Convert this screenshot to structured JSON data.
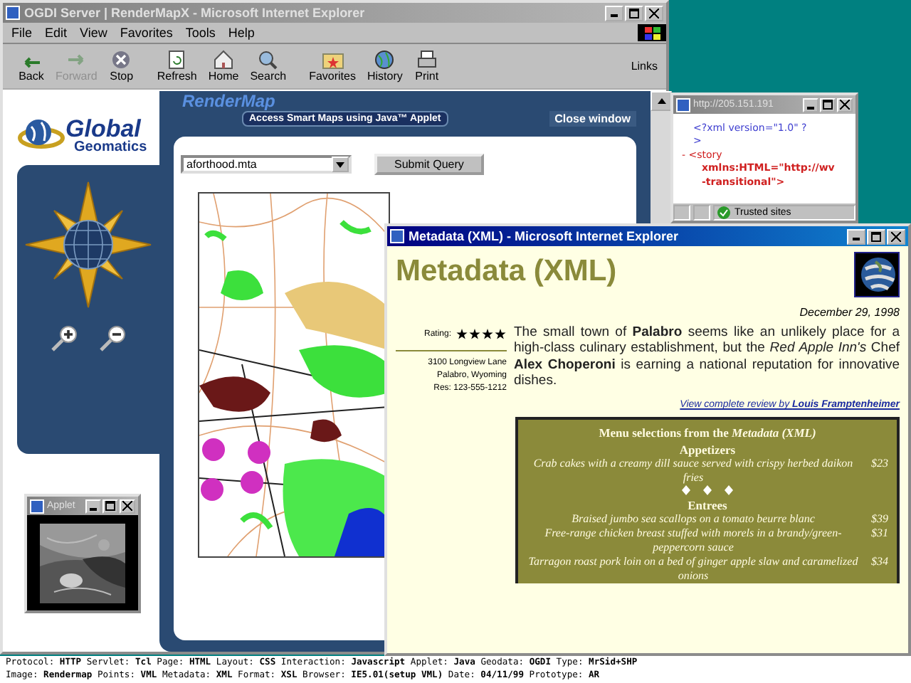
{
  "main_window": {
    "title": "OGDI Server | RenderMapX - Microsoft Internet Explorer",
    "menu": [
      "File",
      "Edit",
      "View",
      "Favorites",
      "Tools",
      "Help"
    ],
    "toolbar": [
      {
        "label": "Back",
        "disabled": false
      },
      {
        "label": "Forward",
        "disabled": true
      },
      {
        "label": "Stop",
        "disabled": false
      },
      {
        "label": "Refresh",
        "disabled": false
      },
      {
        "label": "Home",
        "disabled": false
      },
      {
        "label": "Search",
        "disabled": false
      },
      {
        "label": "Favorites",
        "disabled": false
      },
      {
        "label": "History",
        "disabled": false
      },
      {
        "label": "Print",
        "disabled": false
      }
    ],
    "links": "Links",
    "logo": {
      "line1": "Global",
      "line2": "Geomatics"
    },
    "rendermap": {
      "title": "RenderMap",
      "tagline": "Access Smart Maps using Java™ Applet",
      "close": "Close window",
      "file": "aforthood.mta",
      "submit": "Submit Query"
    }
  },
  "applet_window": {
    "title": "Applet"
  },
  "xml_window": {
    "title": "http://205.151.191",
    "lines": [
      {
        "text": "<?xml version=\"1.0\" ?",
        "color": "#4040d0"
      },
      {
        "text": ">",
        "color": "#4040d0"
      },
      {
        "text": "- <story",
        "color": "#d02020"
      },
      {
        "text": "xmlns:HTML=\"http://wv",
        "color": "#d02020"
      },
      {
        "text": "-transitional\">",
        "color": "#d02020"
      }
    ],
    "status": "Trusted sites"
  },
  "metadata_window": {
    "title": "Metadata (XML) - Microsoft Internet Explorer",
    "heading": "Metadata (XML)",
    "date": "December 29, 1998",
    "rating_label": "Rating:",
    "stars": 4,
    "address": [
      "3100 Longview Lane",
      "Palabro, Wyoming",
      "Res: 123-555-1212"
    ],
    "review": "The small town of **Palabro** seems like an unlikely place for a high-class culinary establishment, but the *Red Apple Inn's* Chef **Alex Choperoni** is earning a national reputation for innovative dishes.",
    "review_link": "View complete review by **Louis Framptenheimer**",
    "menu_title": "Menu selections from the *Metadata (XML)*",
    "sections": [
      {
        "name": "Appetizers",
        "items": [
          {
            "dish": "Crab cakes with a creamy dill sauce served with crispy herbed daikon fries",
            "price": "$23"
          }
        ]
      },
      {
        "name": "Entrees",
        "items": [
          {
            "dish": "Braised jumbo sea scallops on a tomato beurre blanc",
            "price": "$39"
          },
          {
            "dish": "Free-range chicken breast stuffed with morels in a brandy/green-peppercorn sauce",
            "price": "$31"
          },
          {
            "dish": "Tarragon roast pork loin on a bed of ginger apple slaw and caramelized onions",
            "price": "$34"
          }
        ]
      }
    ]
  },
  "info_lines": [
    "Protocol: **HTTP** Servlet: **Tcl** Page: **HTML** Layout: **CSS** Interaction: **Javascript** Applet: **Java** Geodata: **OGDI** Type: **MrSid+SHP**",
    "Image: **Rendermap** Points: **VML** Metadata: **XML** Format: **XSL** Browser: **IE5.01(setup VML)** Date: **04/11/99** Prototype: **AR**"
  ]
}
